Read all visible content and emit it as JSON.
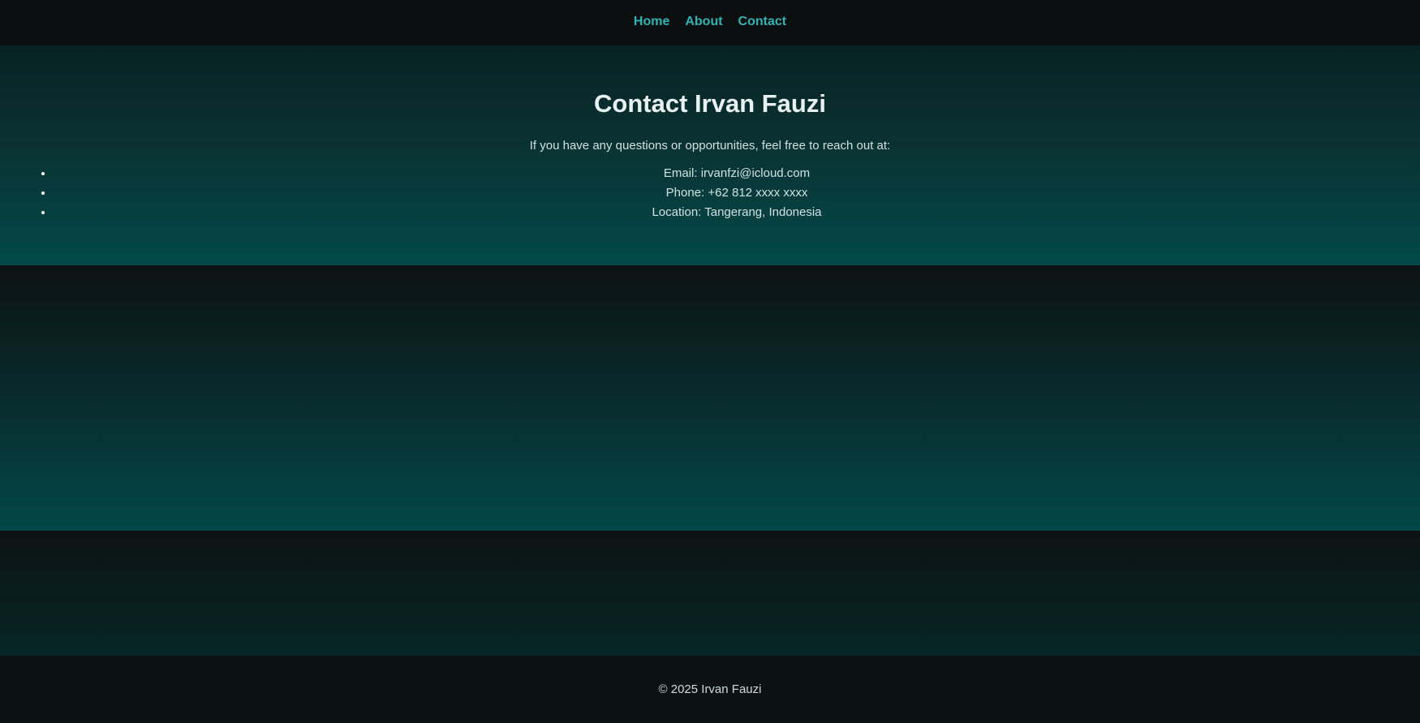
{
  "nav": {
    "items": [
      {
        "label": "Home"
      },
      {
        "label": "About"
      },
      {
        "label": "Contact"
      }
    ]
  },
  "contact": {
    "title": "Contact Irvan Fauzi",
    "intro": "If you have any questions or opportunities, feel free to reach out at:",
    "items": [
      {
        "text": "Email: irvanfzi@icloud.com"
      },
      {
        "text": "Phone: +62 812 xxxx xxxx"
      },
      {
        "text": "Location: Tangerang, Indonesia"
      }
    ]
  },
  "footer": {
    "copyright": "© 2025 Irvan Fauzi"
  },
  "colors": {
    "accent": "#2fb3b3",
    "background": "#0b1113",
    "teal_dark": "#082223",
    "teal_light": "#02494a"
  }
}
